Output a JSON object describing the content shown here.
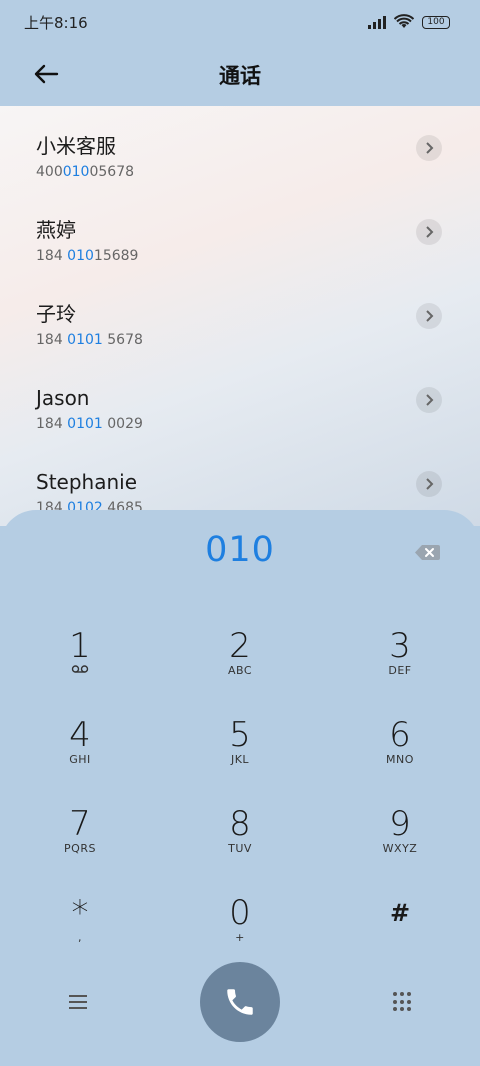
{
  "status": {
    "time": "上午8:16",
    "battery": "100"
  },
  "header": {
    "title": "通话"
  },
  "contacts": [
    {
      "name": "小米客服",
      "num_pre": "400",
      "num_hl": "010",
      "num_post": "05678"
    },
    {
      "name": "燕婷",
      "num_pre": "184 ",
      "num_hl": "010",
      "num_post": "15689"
    },
    {
      "name": "子玲",
      "num_pre": "184 ",
      "num_hl": "0101",
      "num_post": " 5678"
    },
    {
      "name": "Jason",
      "num_pre": "184 ",
      "num_hl": "0101",
      "num_post": " 0029"
    },
    {
      "name": "Stephanie",
      "num_pre": "184 ",
      "num_hl": "0102",
      "num_post": " 4685"
    }
  ],
  "dialer": {
    "input": "010",
    "keys": [
      {
        "digit": "1",
        "letters": ""
      },
      {
        "digit": "2",
        "letters": "ABC"
      },
      {
        "digit": "3",
        "letters": "DEF"
      },
      {
        "digit": "4",
        "letters": "GHI"
      },
      {
        "digit": "5",
        "letters": "JKL"
      },
      {
        "digit": "6",
        "letters": "MNO"
      },
      {
        "digit": "7",
        "letters": "PQRS"
      },
      {
        "digit": "8",
        "letters": "TUV"
      },
      {
        "digit": "9",
        "letters": "WXYZ"
      },
      {
        "digit": "*",
        "letters": ","
      },
      {
        "digit": "0",
        "letters": "+"
      },
      {
        "digit": "#",
        "letters": ""
      }
    ]
  },
  "colors": {
    "accent": "#1e7fe0",
    "panel": "#b5cde3",
    "call_button": "#6b849d"
  },
  "icons": {
    "back": "arrow-left-icon",
    "chevron": "chevron-right-icon",
    "backspace": "backspace-icon",
    "voicemail": "voicemail-icon",
    "menu": "menu-icon",
    "call": "phone-icon",
    "keypad": "keypad-icon"
  }
}
